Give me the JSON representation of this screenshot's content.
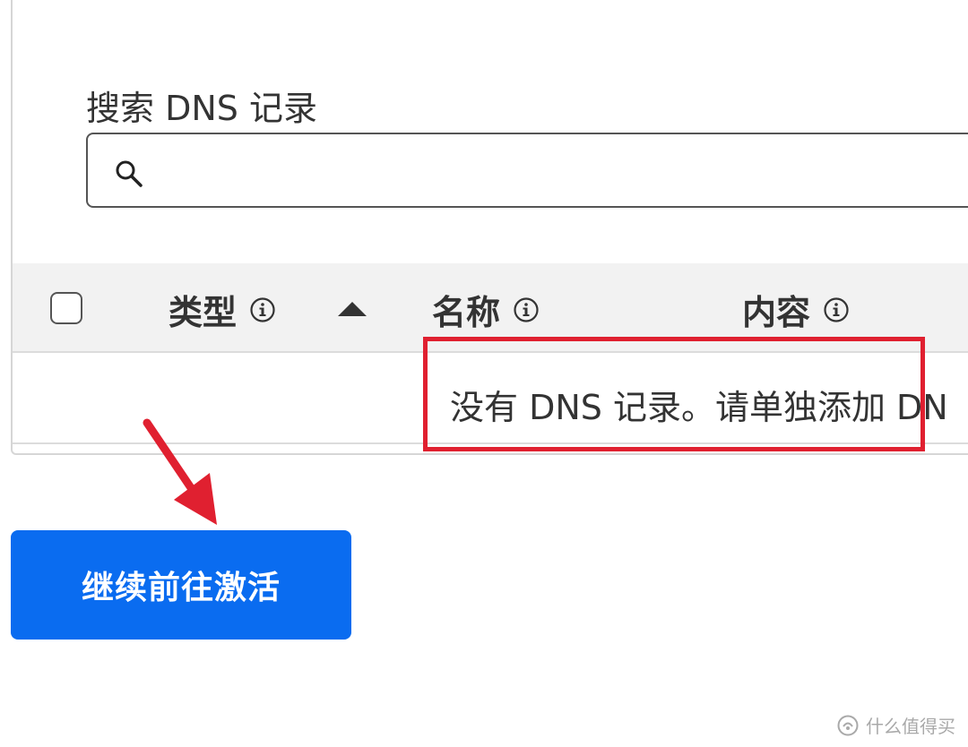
{
  "search": {
    "label": "搜索 DNS 记录",
    "value": "",
    "placeholder": ""
  },
  "table": {
    "columns": [
      {
        "label": "类型",
        "info_icon": "info-circle-icon",
        "sorted": "ascending"
      },
      {
        "label": "名称",
        "info_icon": "info-circle-icon"
      },
      {
        "label": "内容",
        "info_icon": "info-circle-icon"
      }
    ],
    "empty_message": "没有 DNS 记录。请单独添加 DN"
  },
  "action": {
    "continue_label": "继续前往激活"
  },
  "annotation": {
    "highlight_color": "#e02030",
    "arrow_color": "#e02030"
  },
  "watermark": {
    "text": "什么值得买"
  },
  "colors": {
    "primary": "#0a6cf0",
    "header_bg": "#f2f2f2",
    "border": "#d6d6d6"
  }
}
